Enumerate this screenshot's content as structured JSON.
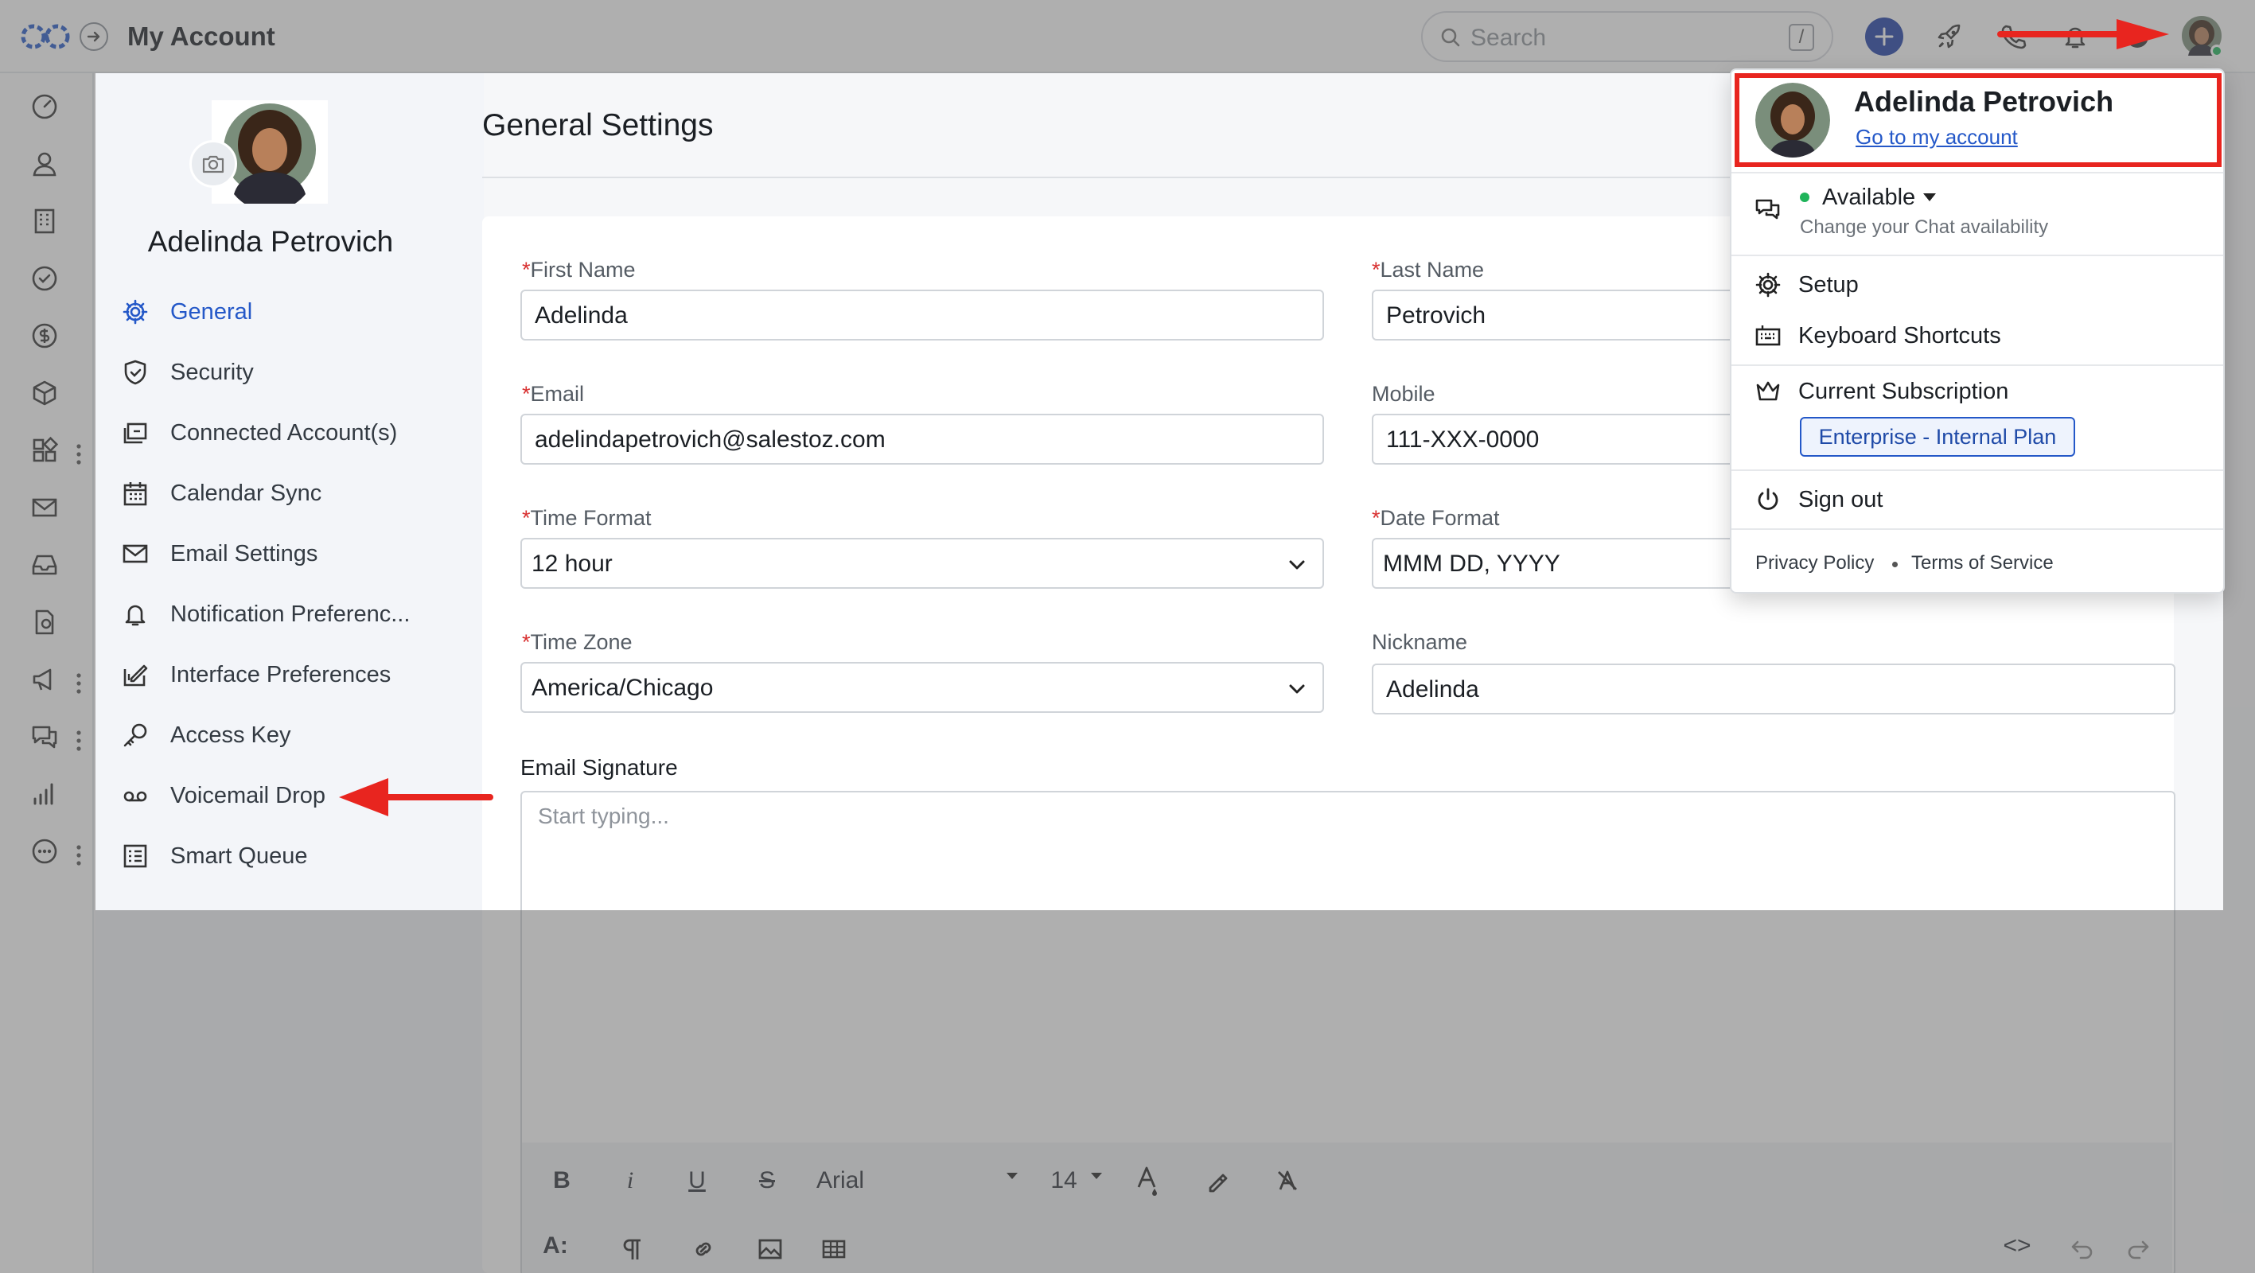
{
  "header": {
    "title": "My Account",
    "search_placeholder": "Search",
    "search_shortcut": "/"
  },
  "rail": {
    "items": [
      "dashboard-icon",
      "contacts-icon",
      "accounts-icon",
      "tasks-icon",
      "deals-icon",
      "products-icon",
      "apps-icon",
      "email-icon",
      "inbox-icon",
      "documents-icon",
      "campaigns-icon",
      "chat-icon",
      "reports-icon",
      "more-icon"
    ]
  },
  "profile": {
    "name": "Adelinda Petrovich"
  },
  "nav": {
    "items": [
      {
        "label": "General",
        "icon": "gear-icon",
        "active": true
      },
      {
        "label": "Security",
        "icon": "shield-icon"
      },
      {
        "label": "Connected Account(s)",
        "icon": "connected-accounts-icon"
      },
      {
        "label": "Calendar Sync",
        "icon": "calendar-icon"
      },
      {
        "label": "Email Settings",
        "icon": "envelope-icon"
      },
      {
        "label": "Notification Preferenc...",
        "icon": "bell-icon"
      },
      {
        "label": "Interface Preferences",
        "icon": "interface-icon"
      },
      {
        "label": "Access Key",
        "icon": "key-icon"
      },
      {
        "label": "Voicemail Drop",
        "icon": "voicemail-icon"
      },
      {
        "label": "Smart Queue",
        "icon": "queue-icon"
      }
    ]
  },
  "main": {
    "title": "General Settings",
    "required_mark": "*",
    "fields": {
      "first_name": {
        "label": "First Name",
        "value": "Adelinda",
        "required": true
      },
      "last_name": {
        "label": "Last Name",
        "value": "Petrovich",
        "required": true
      },
      "email": {
        "label": "Email",
        "value": "adelindapetrovich@salestoz.com",
        "required": true
      },
      "mobile": {
        "label": "Mobile",
        "value": "111-XXX-0000"
      },
      "time_format": {
        "label": "Time Format",
        "value": "12 hour",
        "required": true
      },
      "date_format": {
        "label": "Date Format",
        "value": "MMM DD, YYYY",
        "required": true
      },
      "time_zone": {
        "label": "Time Zone",
        "value": "America/Chicago",
        "required": true
      },
      "nickname": {
        "label": "Nickname",
        "value": "Adelinda"
      }
    },
    "signature": {
      "label": "Email Signature",
      "placeholder": "Start typing..."
    },
    "editor": {
      "bold": "B",
      "italic": "i",
      "underline": "U",
      "strike": "S",
      "font": "Arial",
      "size": "14",
      "paragraph_style": "A:",
      "code": "<>"
    }
  },
  "dropdown": {
    "name": "Adelinda Petrovich",
    "link": "Go to my account",
    "status": "Available",
    "status_sub": "Change your Chat availability",
    "setup": "Setup",
    "shortcuts": "Keyboard Shortcuts",
    "subscription": "Current Subscription",
    "plan": "Enterprise - Internal Plan",
    "signout": "Sign out",
    "privacy": "Privacy Policy",
    "terms": "Terms of Service"
  },
  "colors": {
    "accent": "#2458c8",
    "highlight": "#e8251f",
    "status_green": "#1fb45a",
    "plus_button": "#1f3fa6"
  }
}
